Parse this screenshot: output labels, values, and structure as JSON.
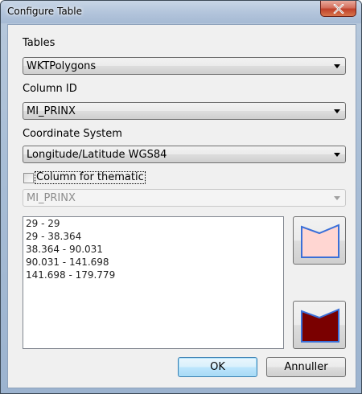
{
  "window": {
    "title": "Configure Table"
  },
  "tables": {
    "label": "Tables",
    "value": "WKTPolygons"
  },
  "column_id": {
    "label": "Column ID",
    "value": "MI_PRINX"
  },
  "coordinate_system": {
    "label": "Coordinate System",
    "value": "Longitude/Latitude WGS84"
  },
  "thematic": {
    "checkbox_label": "Column for thematic",
    "checked": false,
    "column_value": "MI_PRINX"
  },
  "ranges": [
    "29 - 29",
    "29 - 38.364",
    "38.364 - 90.031",
    "90.031 - 141.698",
    "141.698 - 179.779"
  ],
  "styles": {
    "start_fill": "#ffd6d2",
    "start_border": "#3a6fd8",
    "end_fill": "#7a0000",
    "end_border": "#3a6fd8"
  },
  "buttons": {
    "ok": "OK",
    "cancel": "Annuller"
  }
}
